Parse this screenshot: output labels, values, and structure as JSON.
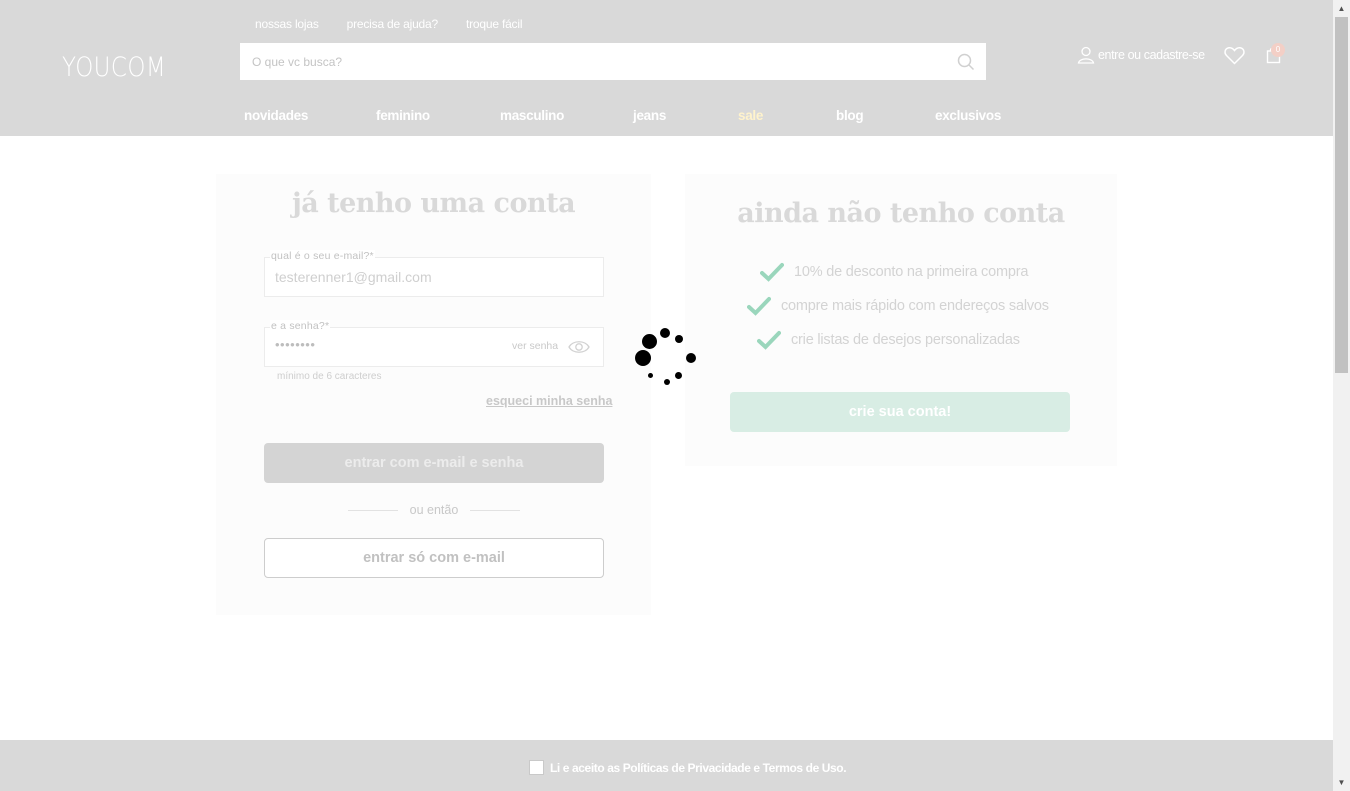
{
  "header": {
    "logo": "YOUCOM",
    "top_links": [
      "nossas lojas",
      "precisa de ajuda?",
      "troque fácil"
    ],
    "search_placeholder": "O que vc busca?",
    "account_label": "entre ou cadastre-se",
    "cart_count": "0",
    "nav": [
      "novidades",
      "feminino",
      "masculino",
      "jeans",
      "sale",
      "blog",
      "exclusivos"
    ],
    "sale_color": "#fff3cc"
  },
  "login": {
    "title": "já tenho uma conta",
    "email_label": "qual é o seu e-mail?*",
    "email_value": "testerenner1@gmail.com",
    "password_label": "e a senha?*",
    "password_value": "••••••••",
    "show_password": "ver senha",
    "hint": "mínimo de 6 caracteres",
    "forgot": "esqueci minha senha",
    "login_button": "entrar com e-mail e senha",
    "or": "ou então",
    "email_only_button": "entrar só com e-mail"
  },
  "register": {
    "title": "ainda não tenho conta",
    "benefits": [
      "10% de desconto na primeira compra",
      "compre mais rápido com endereços salvos",
      "crie listas de desejos personalizadas"
    ],
    "create_button": "crie sua conta!",
    "check_color": "#9ad6bc"
  },
  "footer": {
    "consent": "Li e aceito as Políticas de Privacidade e Termos de Uso."
  }
}
